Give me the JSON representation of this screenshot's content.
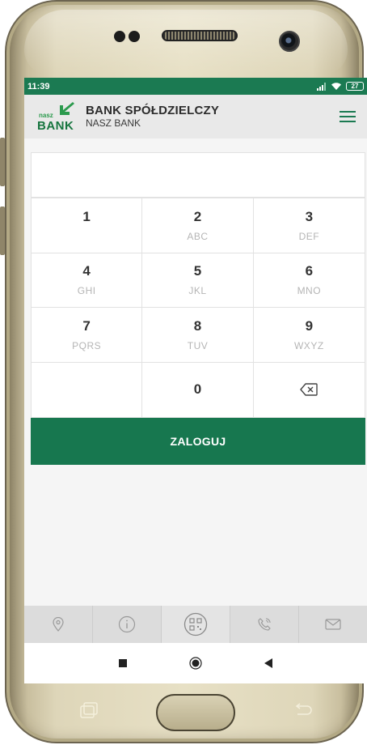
{
  "status_bar": {
    "time": "11:39",
    "battery": "27"
  },
  "header": {
    "logo_small": "nasz",
    "logo_big": "BANK",
    "title": "BANK SPÓŁDZIELCZY",
    "subtitle": "NASZ BANK"
  },
  "pin": {
    "value": ""
  },
  "keypad": [
    {
      "num": "1",
      "letters": ""
    },
    {
      "num": "2",
      "letters": "ABC"
    },
    {
      "num": "3",
      "letters": "DEF"
    },
    {
      "num": "4",
      "letters": "GHI"
    },
    {
      "num": "5",
      "letters": "JKL"
    },
    {
      "num": "6",
      "letters": "MNO"
    },
    {
      "num": "7",
      "letters": "PQRS"
    },
    {
      "num": "8",
      "letters": "TUV"
    },
    {
      "num": "9",
      "letters": "WXYZ"
    },
    {
      "num": "",
      "letters": ""
    },
    {
      "num": "0",
      "letters": ""
    }
  ],
  "login_label": "ZALOGUJ",
  "bottom_tabs": [
    "location-icon",
    "info-icon",
    "qr-code-icon",
    "phone-call-icon",
    "mail-icon"
  ],
  "colors": {
    "brand_green": "#17774f",
    "status_green": "#1b7a52",
    "logo_green": "#2b9a4d"
  }
}
